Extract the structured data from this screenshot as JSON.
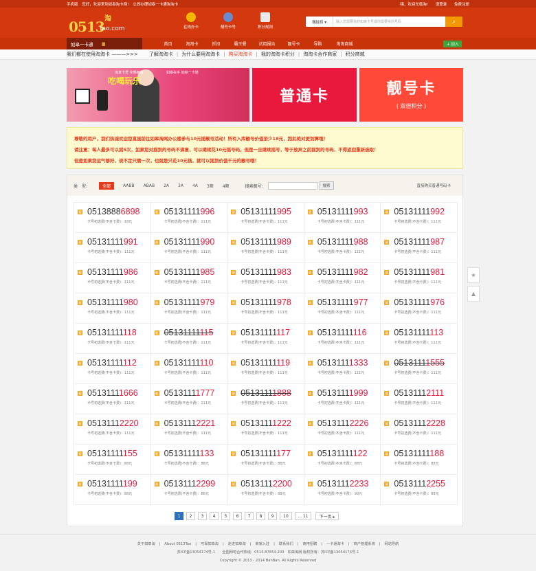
{
  "topbar": {
    "left": [
      "手机版",
      "您好，欢迎来到如皋淘卡网!",
      "立即办理如皋一卡通淘淘卡"
    ],
    "right": [
      "嗨，欢迎光临淘!",
      "请登录",
      "免费注册"
    ]
  },
  "logo": {
    "num": "0513",
    "domain": "tao.com",
    "tao": "淘"
  },
  "header_links": [
    {
      "label": "在线办卡",
      "color": "#f5b800"
    },
    {
      "label": "靓号卡号",
      "color": "#6a8ccd"
    },
    {
      "label": "积分规则",
      "color": "#e9e9e9"
    }
  ],
  "search": {
    "category": "搜挂扣 ▾",
    "placeholder": "输入您需要找的如皋卡号或你需要买的号码",
    "icon": "search-icon"
  },
  "nav": {
    "brand": "如皋一卡通",
    "items": [
      "首页",
      "淘淘卡",
      "折扣",
      "霸王餐",
      "试用报告",
      "靓号卡",
      "导购",
      "淘淘商城"
    ],
    "add": "+ 加入"
  },
  "subnav": {
    "lead": "我们都在使用淘淘卡 ———>>>",
    "items": [
      "了解淘淘卡",
      "为什么要用淘淘卡",
      "购买淘淘卡",
      "我的淘淘卡积分",
      "淘淘卡合作商家",
      "积分商城"
    ],
    "active_index": 2
  },
  "banner": {
    "b1_t1": "淘享卡费 全部拥有",
    "b1_t2": "吃喝玩乐",
    "b1_t3": "如皋在手 如皋一卡通",
    "b2": "普通卡",
    "b3_title": "靓号卡",
    "b3_sub": "( 双倍积分 )"
  },
  "notice": [
    "尊敬的用户，我们热诚欢迎您直接前往如皋淘网办公楼参与10元摇靓号活动！所有入库靓号价值至少18元，因此绝对更划算哦！",
    "请注意：每人最多可以摇5次，如果您对摇到的号码不满意，可以继续花10元摇号码，但是一旦继续摇号，等于放弃之前摇到的号码，不得返回重新选取！",
    "但是如果您运气够好，说不定只需一次，也就是只花10元钱，就可以摇到价值千元的靓号哦！"
  ],
  "filter": {
    "label": "类　型：",
    "options": [
      "全部",
      "AABB",
      "ABAB",
      "2A",
      "3A",
      "4A",
      "3顺",
      "4顺"
    ],
    "active_index": 0,
    "search_label": "搜索靓号：",
    "search_btn": "搜索",
    "right": "直接购买普通号码卡"
  },
  "badge": "靓",
  "cards": [
    {
      "pre": "0513888",
      "suf": "6898",
      "det": "卡号初选费(不含卡费)：18元",
      "strike": false
    },
    {
      "pre": "05131111",
      "suf": "996",
      "det": "卡号初选费(不含卡费)：111元",
      "strike": false
    },
    {
      "pre": "05131111",
      "suf": "995",
      "det": "卡号初选费(不含卡费)：111元",
      "strike": false
    },
    {
      "pre": "05131111",
      "suf": "993",
      "det": "卡号初选费(不含卡费)：111元",
      "strike": false
    },
    {
      "pre": "05131111",
      "suf": "992",
      "det": "卡号初选费(不含卡费)：111元",
      "strike": false
    },
    {
      "pre": "05131111",
      "suf": "991",
      "det": "卡号初选费(不含卡费)：111元",
      "strike": false
    },
    {
      "pre": "05131111",
      "suf": "990",
      "det": "卡号初选费(不含卡费)：111元",
      "strike": false
    },
    {
      "pre": "05131111",
      "suf": "989",
      "det": "卡号初选费(不含卡费)：111元",
      "strike": false
    },
    {
      "pre": "05131111",
      "suf": "988",
      "det": "卡号初选费(不含卡费)：111元",
      "strike": false
    },
    {
      "pre": "05131111",
      "suf": "987",
      "det": "卡号初选费(不含卡费)：111元",
      "strike": false
    },
    {
      "pre": "05131111",
      "suf": "986",
      "det": "卡号初选费(不含卡费)：111元",
      "strike": false
    },
    {
      "pre": "05131111",
      "suf": "985",
      "det": "卡号初选费(不含卡费)：111元",
      "strike": false
    },
    {
      "pre": "05131111",
      "suf": "983",
      "det": "卡号初选费(不含卡费)：111元",
      "strike": false
    },
    {
      "pre": "05131111",
      "suf": "982",
      "det": "卡号初选费(不含卡费)：111元",
      "strike": false
    },
    {
      "pre": "05131111",
      "suf": "981",
      "det": "卡号初选费(不含卡费)：111元",
      "strike": false
    },
    {
      "pre": "05131111",
      "suf": "980",
      "det": "卡号初选费(不含卡费)：111元",
      "strike": false
    },
    {
      "pre": "05131111",
      "suf": "979",
      "det": "卡号初选费(不含卡费)：111元",
      "strike": false
    },
    {
      "pre": "05131111",
      "suf": "978",
      "det": "卡号初选费(不含卡费)：111元",
      "strike": false
    },
    {
      "pre": "05131111",
      "suf": "977",
      "det": "卡号初选费(不含卡费)：111元",
      "strike": false
    },
    {
      "pre": "05131111",
      "suf": "976",
      "det": "卡号初选费(不含卡费)：111元",
      "strike": false
    },
    {
      "pre": "05131111",
      "suf": "118",
      "det": "卡号初选费(不含卡费)：111元",
      "strike": false
    },
    {
      "pre": "05131111",
      "suf": "115",
      "det": "卡号初选费(不含卡费)：111元",
      "strike": true
    },
    {
      "pre": "05131111",
      "suf": "117",
      "det": "卡号初选费(不含卡费)：111元",
      "strike": false
    },
    {
      "pre": "05131111",
      "suf": "116",
      "det": "卡号初选费(不含卡费)：111元",
      "strike": false
    },
    {
      "pre": "05131111",
      "suf": "113",
      "det": "卡号初选费(不含卡费)：111元",
      "strike": false
    },
    {
      "pre": "05131111",
      "suf": "112",
      "det": "卡号初选费(不含卡费)：111元",
      "strike": false
    },
    {
      "pre": "05131111",
      "suf": "110",
      "det": "卡号初选费(不含卡费)：111元",
      "strike": false
    },
    {
      "pre": "05131111",
      "suf": "119",
      "det": "卡号初选费(不含卡费)：111元",
      "strike": false
    },
    {
      "pre": "0513111",
      "suf": "1333",
      "det": "卡号初选费(不含卡费)：111元",
      "strike": false
    },
    {
      "pre": "0513111",
      "suf": "1555",
      "det": "卡号初选费(不含卡费)：111元",
      "strike": true
    },
    {
      "pre": "0513111",
      "suf": "1666",
      "det": "卡号初选费(不含卡费)：111元",
      "strike": false
    },
    {
      "pre": "0513111",
      "suf": "1777",
      "det": "卡号初选费(不含卡费)：111元",
      "strike": false
    },
    {
      "pre": "0513111",
      "suf": "1888",
      "det": "卡号初选费(不含卡费)：111元",
      "strike": true
    },
    {
      "pre": "0513111",
      "suf": "1999",
      "det": "卡号初选费(不含卡费)：111元",
      "strike": false
    },
    {
      "pre": "0513111",
      "suf": "2111",
      "det": "卡号初选费(不含卡费)：111元",
      "strike": false
    },
    {
      "pre": "0513111",
      "suf": "2220",
      "det": "卡号初选费(不含卡费)：111元",
      "strike": false
    },
    {
      "pre": "0513111",
      "suf": "2221",
      "det": "卡号初选费(不含卡费)：111元",
      "strike": false
    },
    {
      "pre": "0513111",
      "suf": "1222",
      "det": "卡号初选费(不含卡费)：111元",
      "strike": false
    },
    {
      "pre": "0513111",
      "suf": "2226",
      "det": "卡号初选费(不含卡费)：111元",
      "strike": false
    },
    {
      "pre": "0513111",
      "suf": "2228",
      "det": "卡号初选费(不含卡费)：111元",
      "strike": false
    },
    {
      "pre": "05131111",
      "suf": "155",
      "det": "卡号初选费(不含卡费)：88元",
      "strike": false
    },
    {
      "pre": "05131111",
      "suf": "133",
      "det": "卡号初选费(不含卡费)：88元",
      "strike": false
    },
    {
      "pre": "05131111",
      "suf": "177",
      "det": "卡号初选费(不含卡费)：88元",
      "strike": false
    },
    {
      "pre": "05131111",
      "suf": "122",
      "det": "卡号初选费(不含卡费)：88元",
      "strike": false
    },
    {
      "pre": "05131111",
      "suf": "188",
      "det": "卡号初选费(不含卡费)：88元",
      "strike": false
    },
    {
      "pre": "05131111",
      "suf": "199",
      "det": "卡号初选费(不含卡费)：88元",
      "strike": false
    },
    {
      "pre": "0513111",
      "suf": "2299",
      "det": "卡号初选费(不含卡费)：88元",
      "strike": false
    },
    {
      "pre": "0513111",
      "suf": "2200",
      "det": "卡号初选费(不含卡费)：88元",
      "strike": false
    },
    {
      "pre": "0513111",
      "suf": "2233",
      "det": "卡号初选费(不含卡费)：99元",
      "strike": false
    },
    {
      "pre": "0513111",
      "suf": "2255",
      "det": "卡号初选费(不含卡费)：88元",
      "strike": false
    }
  ],
  "pager": {
    "pages": [
      "1",
      "2",
      "3",
      "4",
      "5",
      "6",
      "7",
      "8",
      "9",
      "10",
      "... 11",
      "下一页 ▸"
    ],
    "active_index": 0
  },
  "sidebar_icons": [
    "★",
    "▲"
  ],
  "footer": {
    "links": [
      "关于如皋淘",
      "About 0513Tao",
      "可靠如皋淘",
      "走进如皋淘",
      "商家入驻",
      "联系我们",
      "商用招聘",
      "一卡通淘卡",
      "商户管理系统",
      "网站导航"
    ],
    "line2": "苏ICP备13054174号-1　　全国网吧合作热线：0513-87654-203　如皋淘网 版权所有：苏ICP备13054174号-1",
    "copy": "Copyright © 2013 - 2014 BanBan. All Rights Reserved"
  }
}
